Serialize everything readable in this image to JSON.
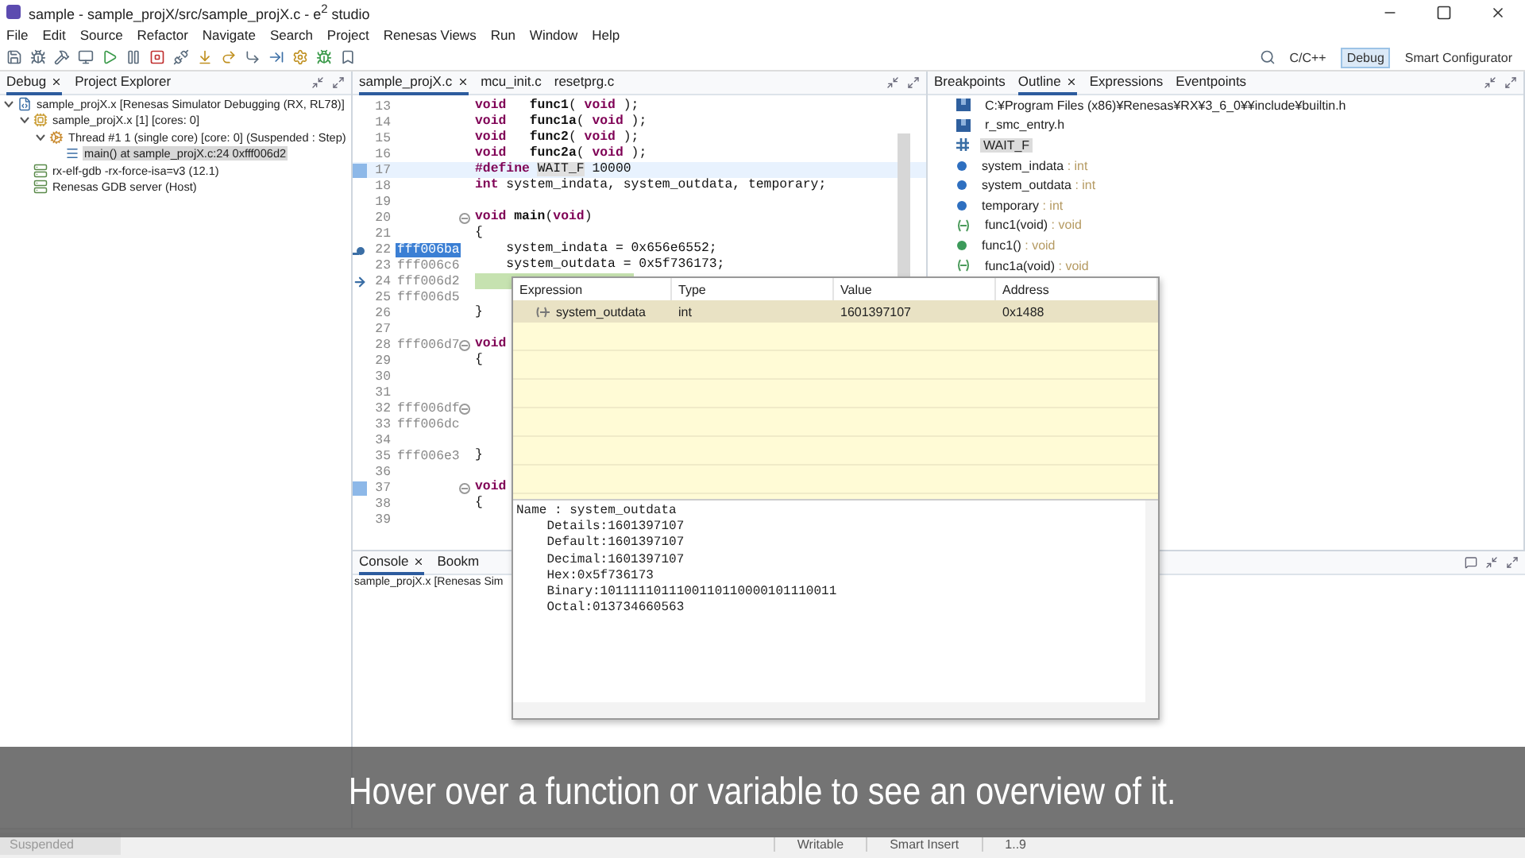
{
  "window": {
    "title": "sample - sample_projX/src/sample_projX.c - e$^{2}$ studio"
  },
  "menu": [
    "File",
    "Edit",
    "Source",
    "Refactor",
    "Navigate",
    "Search",
    "Project",
    "Renesas Views",
    "Run",
    "Window",
    "Help"
  ],
  "perspectives": [
    {
      "label": "C/C++",
      "selected": false
    },
    {
      "label": "Debug",
      "selected": true
    },
    {
      "label": "Smart Configurator",
      "selected": false
    }
  ],
  "debug_panel": {
    "tabs": [
      {
        "label": "Debug",
        "selected": true
      },
      {
        "label": "Project Explorer",
        "selected": false
      }
    ],
    "tree": [
      {
        "label": "sample_projX.x [Renesas Simulator Debugging (RX, RL78)]",
        "kind": "launch",
        "expanded": true,
        "selected": false,
        "children": [
          {
            "label": "sample_projX.x [1] [cores: 0]",
            "kind": "process",
            "expanded": true,
            "selected": false,
            "children": [
              {
                "label": "Thread #1 1 (single core) [core: 0] (Suspended : Step)",
                "kind": "thread",
                "expanded": true,
                "selected": false,
                "children": [
                  {
                    "label": "main() at sample_projX.c:24 0xfff006d2",
                    "kind": "frame",
                    "selected": true
                  }
                ]
              }
            ]
          },
          {
            "label": "rx-elf-gdb -rx-force-isa=v3 (12.1)",
            "kind": "gdb",
            "selected": false
          },
          {
            "label": "Renesas GDB server (Host)",
            "kind": "gdb",
            "selected": false
          }
        ]
      }
    ]
  },
  "editor": {
    "tabs": [
      {
        "label": "sample_projX.c",
        "selected": true
      },
      {
        "label": "mcu_init.c",
        "selected": false
      },
      {
        "label": "resetprg.c",
        "selected": false
      }
    ],
    "lines": [
      {
        "n": "13",
        "kind": "plain",
        "fold": false,
        "code": [
          {
            "t": "void",
            "kind": "keyword"
          },
          {
            "t": "   func1",
            "kind": "function"
          },
          {
            "t": "( ",
            "kind": "plain"
          },
          {
            "t": "void",
            "kind": "keyword"
          },
          {
            "t": " );",
            "kind": "plain"
          }
        ]
      },
      {
        "n": "14",
        "kind": "plain",
        "fold": false,
        "code": [
          {
            "t": "void",
            "kind": "keyword"
          },
          {
            "t": "   func1a",
            "kind": "function"
          },
          {
            "t": "( ",
            "kind": "plain"
          },
          {
            "t": "void",
            "kind": "keyword"
          },
          {
            "t": " );",
            "kind": "plain"
          }
        ]
      },
      {
        "n": "15",
        "kind": "plain",
        "fold": false,
        "code": [
          {
            "t": "void",
            "kind": "keyword"
          },
          {
            "t": "   func2",
            "kind": "function"
          },
          {
            "t": "( ",
            "kind": "plain"
          },
          {
            "t": "void",
            "kind": "keyword"
          },
          {
            "t": " );",
            "kind": "plain"
          }
        ]
      },
      {
        "n": "16",
        "kind": "plain",
        "fold": false,
        "code": [
          {
            "t": "void",
            "kind": "keyword"
          },
          {
            "t": "   func2a",
            "kind": "function"
          },
          {
            "t": "( ",
            "kind": "plain"
          },
          {
            "t": "void",
            "kind": "keyword"
          },
          {
            "t": " );",
            "kind": "plain"
          }
        ]
      },
      {
        "n": "17",
        "kind": "cursor",
        "fold": false,
        "marker": {
          "kind": "bookmark"
        },
        "code": [
          {
            "t": "#define ",
            "kind": "keyword"
          },
          {
            "t": "WAIT_F",
            "kind": "occurrence"
          },
          {
            "t": " 10000",
            "kind": "plain"
          }
        ]
      },
      {
        "n": "18",
        "kind": "plain",
        "fold": false,
        "code": [
          {
            "t": "int",
            "kind": "keyword"
          },
          {
            "t": " system_indata, system_outdata, temporary;",
            "kind": "plain"
          }
        ]
      },
      {
        "n": "19",
        "kind": "plain",
        "fold": false
      },
      {
        "n": "20",
        "kind": "plain",
        "fold": true,
        "code": [
          {
            "t": "void",
            "kind": "keyword"
          },
          {
            "t": " main",
            "kind": "function"
          },
          {
            "t": "(",
            "kind": "plain"
          },
          {
            "t": "void",
            "kind": "keyword"
          },
          {
            "t": ")",
            "kind": "plain"
          }
        ]
      },
      {
        "n": "21",
        "kind": "plain",
        "fold": false,
        "code": [
          {
            "t": "{",
            "kind": "plain"
          }
        ]
      },
      {
        "n": "22",
        "addr": "fff006ba",
        "kind": "plain",
        "fold": false,
        "selected": true,
        "marker": {
          "kind": "breakpoint"
        },
        "code": [
          {
            "t": "    system_indata = 0x656e6552;",
            "kind": "plain"
          }
        ]
      },
      {
        "n": "23",
        "addr": "fff006c6",
        "kind": "plain",
        "fold": false,
        "selected": false,
        "code": [
          {
            "t": "    system_outdata = 0x5f736173;",
            "kind": "plain"
          }
        ]
      },
      {
        "n": "24",
        "addr": "fff006d2",
        "kind": "exec",
        "fold": false,
        "selected": false,
        "marker": {
          "kind": "pc"
        }
      },
      {
        "n": "25",
        "addr": "fff006d5",
        "kind": "plain",
        "fold": false,
        "selected": false
      },
      {
        "n": "26",
        "kind": "plain",
        "fold": false,
        "code": [
          {
            "t": "}",
            "kind": "plain"
          }
        ]
      },
      {
        "n": "27",
        "kind": "plain",
        "fold": false
      },
      {
        "n": "28",
        "addr": "fff006d7",
        "kind": "plain",
        "fold": true,
        "selected": false,
        "code": [
          {
            "t": "void",
            "kind": "keyword"
          }
        ]
      },
      {
        "n": "29",
        "kind": "plain",
        "fold": false,
        "code": [
          {
            "t": "{",
            "kind": "plain"
          }
        ]
      },
      {
        "n": "30",
        "kind": "plain",
        "fold": false
      },
      {
        "n": "31",
        "kind": "plain",
        "fold": false
      },
      {
        "n": "32",
        "addr": "fff006df",
        "kind": "plain",
        "fold": true,
        "selected": false
      },
      {
        "n": "33",
        "addr": "fff006dc",
        "kind": "plain",
        "fold": false,
        "selected": false
      },
      {
        "n": "34",
        "kind": "plain",
        "fold": false
      },
      {
        "n": "35",
        "addr": "fff006e3",
        "kind": "plain",
        "fold": false,
        "selected": false,
        "code": [
          {
            "t": "}",
            "kind": "plain"
          }
        ]
      },
      {
        "n": "36",
        "kind": "plain",
        "fold": false
      },
      {
        "n": "37",
        "kind": "plain",
        "fold": true,
        "marker": {
          "kind": "bookmark"
        },
        "code": [
          {
            "t": "void",
            "kind": "keyword"
          }
        ]
      },
      {
        "n": "38",
        "kind": "plain",
        "fold": false,
        "code": [
          {
            "t": "{",
            "kind": "plain"
          }
        ]
      },
      {
        "n": "39",
        "kind": "plain",
        "fold": false
      }
    ]
  },
  "outline_panel": {
    "tabs": [
      {
        "label": "Breakpoints",
        "selected": false
      },
      {
        "label": "Outline",
        "selected": true
      },
      {
        "label": "Expressions",
        "selected": false
      },
      {
        "label": "Eventpoints",
        "selected": false
      }
    ],
    "items": [
      {
        "kind": "include",
        "name": "C:¥Program Files (x86)¥Renesas¥RX¥3_6_0¥¥include¥builtin.h",
        "selected": false
      },
      {
        "kind": "include",
        "name": "r_smc_entry.h",
        "selected": false
      },
      {
        "kind": "define",
        "name": "WAIT_F",
        "selected": true
      },
      {
        "kind": "variable",
        "name": "system_indata",
        "type": " : int",
        "selected": false
      },
      {
        "kind": "variable",
        "name": "system_outdata",
        "type": " : int",
        "selected": false
      },
      {
        "kind": "variable",
        "name": "temporary",
        "type": " : int",
        "selected": false
      },
      {
        "kind": "prototype",
        "name": "func1(void)",
        "type": " : void",
        "selected": false
      },
      {
        "kind": "function",
        "name": "func1()",
        "type": " : void",
        "selected": false
      },
      {
        "kind": "prototype",
        "name": "func1a(void)",
        "type": " : void",
        "selected": false
      }
    ]
  },
  "console_panel": {
    "tabs": [
      {
        "label": "Console",
        "selected": true
      },
      {
        "label": "Bookm",
        "selected": false
      }
    ],
    "text": "sample_projX.x [Renesas Sim"
  },
  "hover": {
    "columns": [
      "Expression",
      "Type",
      "Value",
      "Address"
    ],
    "row": {
      "expression": "system_outdata",
      "type": "int",
      "value": "1601397107",
      "address": "0x1488"
    },
    "details": [
      "Name : system_outdata",
      "    Details:1601397107",
      "    Default:1601397107",
      "    Decimal:1601397107",
      "    Hex:0x5f736173",
      "    Binary:1011111011100110110000101110011",
      "    Octal:013734660563"
    ]
  },
  "caption": "Hover over a function or variable to see an overview of it.",
  "status_bar": {
    "state": "Suspended",
    "fields": [
      "Writable",
      "Smart Insert",
      "1..9"
    ]
  }
}
